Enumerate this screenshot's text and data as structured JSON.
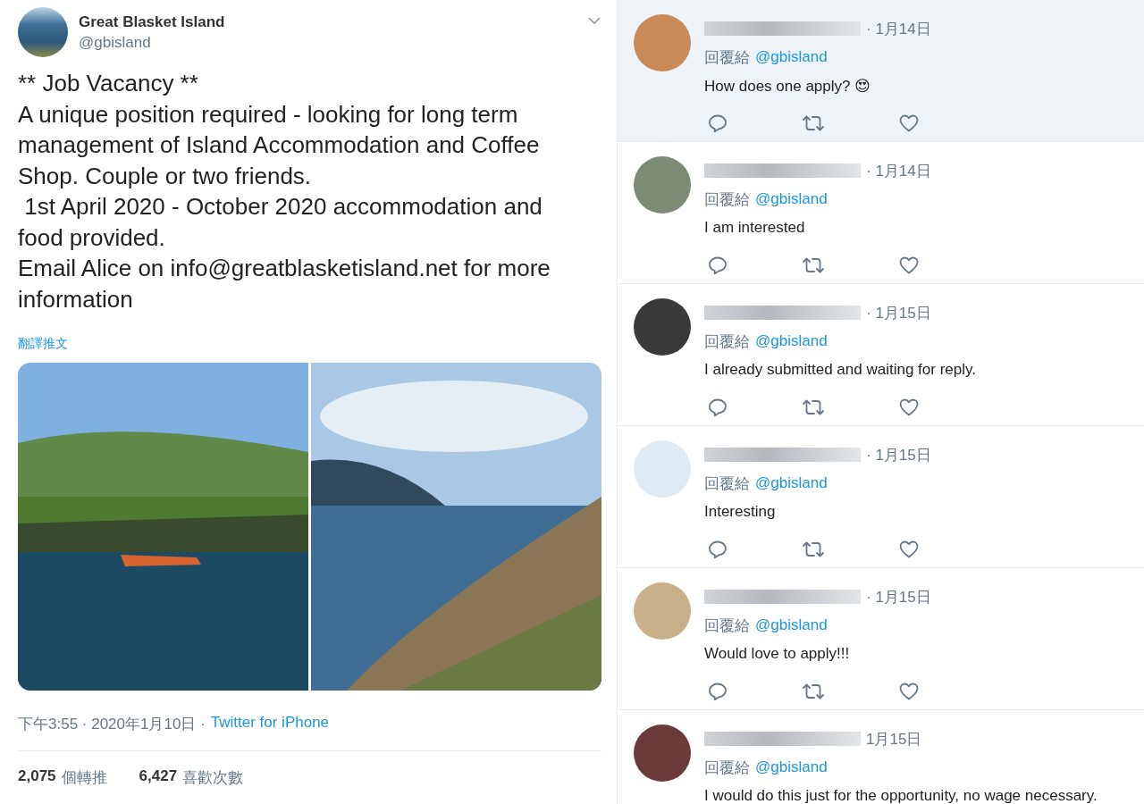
{
  "tweet": {
    "author": {
      "name": "Great Blasket Island",
      "handle": "@gbisland"
    },
    "body": [
      "** Job Vacancy **",
      "A unique position required - looking for long term management of Island Accommodation and Coffee Shop. Couple or two friends.",
      " 1st April 2020 - October 2020 accommodation and food provided.",
      "Email Alice on info@greatblasketisland.net for more information"
    ],
    "translate_link": "翻譯推文",
    "timestamp": "下午3:55 · 2020年1月10日 ·",
    "source": "Twitter for iPhone",
    "stats": [
      {
        "count": "2,075",
        "label": "個轉推"
      },
      {
        "count": "6,427",
        "label": "喜歡次數"
      }
    ]
  },
  "replies": [
    {
      "date": "· 1月14日",
      "reply_to_label": "回覆給",
      "reply_to": "@gbisland",
      "text": "How does one apply? 😍",
      "highlighted": true
    },
    {
      "date": "· 1月14日",
      "reply_to_label": "回覆給",
      "reply_to": "@gbisland",
      "text": "I am interested",
      "highlighted": false
    },
    {
      "date": "· 1月15日",
      "reply_to_label": "回覆給",
      "reply_to": "@gbisland",
      "text": "I already submitted and waiting for reply.",
      "highlighted": false
    },
    {
      "date": "· 1月15日",
      "reply_to_label": "回覆給",
      "reply_to": "@gbisland",
      "text": "Interesting",
      "highlighted": false
    },
    {
      "date": "· 1月15日",
      "reply_to_label": "回覆給",
      "reply_to": "@gbisland",
      "text": "Would love to apply!!!",
      "highlighted": false
    },
    {
      "date": "1月15日",
      "reply_to_label": "回覆給",
      "reply_to": "@gbisland",
      "text": "I would do this just for the opportunity, no wage necessary.",
      "highlighted": false
    }
  ]
}
